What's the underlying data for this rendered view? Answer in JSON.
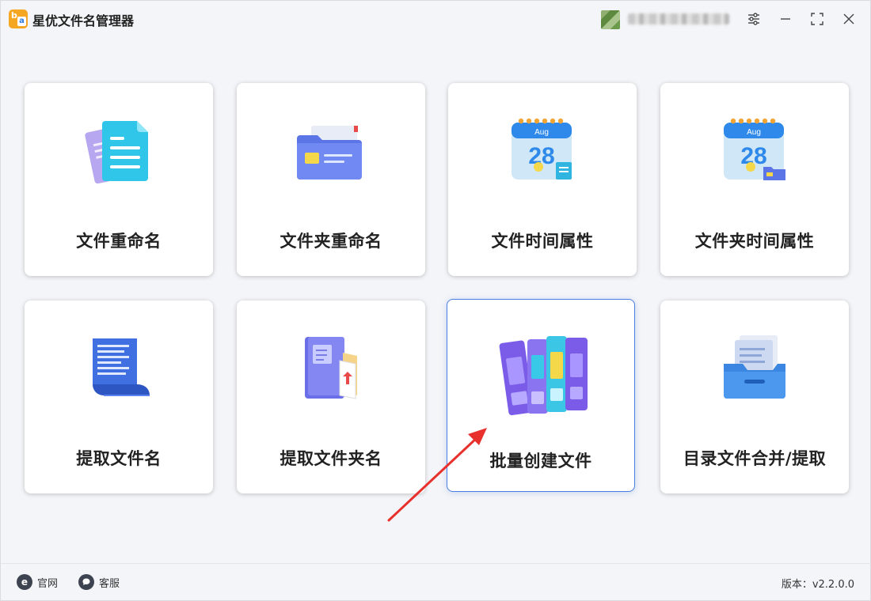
{
  "app": {
    "title": "星优文件名管理器",
    "logo_left": "b",
    "logo_right": "a"
  },
  "titlebar": {
    "icons": [
      "settings-icon",
      "minimize-icon",
      "maximize-icon",
      "close-icon"
    ]
  },
  "tools": [
    {
      "label": "文件重命名",
      "icon": "file-rename-icon"
    },
    {
      "label": "文件夹重命名",
      "icon": "folder-rename-icon"
    },
    {
      "label": "文件时间属性",
      "icon": "file-calendar-icon"
    },
    {
      "label": "文件夹时间属性",
      "icon": "folder-calendar-icon"
    },
    {
      "label": "提取文件名",
      "icon": "scroll-document-icon"
    },
    {
      "label": "提取文件夹名",
      "icon": "folder-extract-icon"
    },
    {
      "label": "批量创建文件",
      "icon": "binders-icon",
      "selected": true
    },
    {
      "label": "目录文件合并/提取",
      "icon": "file-tray-icon"
    }
  ],
  "calendar_month": "Aug",
  "calendar_day": "28",
  "footer": {
    "website_label": "官网",
    "website_icon_letter": "e",
    "support_label": "客服",
    "version_text": "版本：v2.2.0.0"
  },
  "colors": {
    "accent": "#4a7ee0",
    "annotation_arrow": "#e8312c"
  }
}
